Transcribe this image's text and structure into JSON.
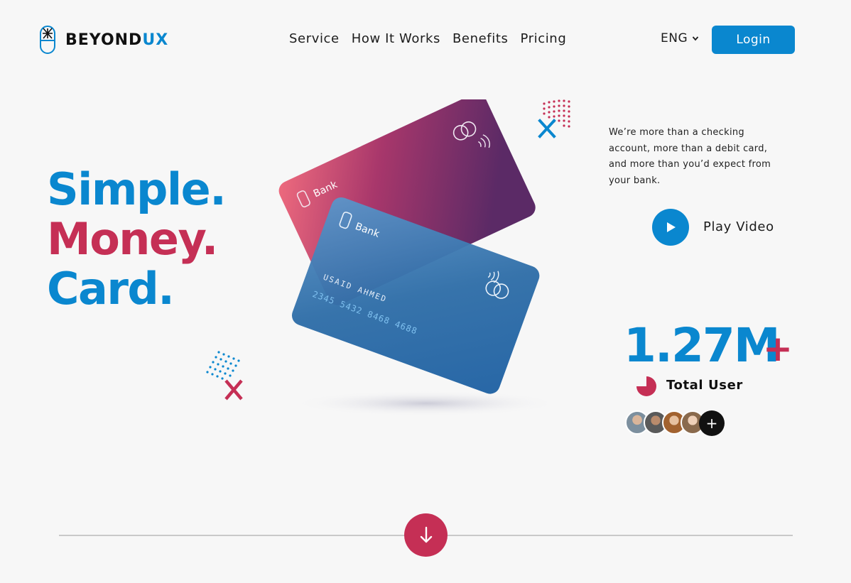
{
  "brand": {
    "name_part1": "BEYOND",
    "name_part2": "UX"
  },
  "nav": [
    {
      "label": "Service"
    },
    {
      "label": "How It Works"
    },
    {
      "label": "Benefits"
    },
    {
      "label": "Pricing"
    }
  ],
  "language": {
    "selected": "ENG"
  },
  "login_label": "Login",
  "hero": {
    "line1": "Simple.",
    "line2": "Money.",
    "line3": "Card."
  },
  "cards": {
    "back_bank": "Bank",
    "front_bank": "Bank",
    "holder": "USAID AHMED",
    "number": "2345 5432 8468 4688"
  },
  "description": "We’re more than a checking account, more than a debit card, and more than you’d expect from your bank.",
  "play_label": "Play Video",
  "stats": {
    "value": "1.27M",
    "suffix": "+",
    "label": "Total User",
    "add_label": "+"
  },
  "colors": {
    "blue": "#0a87cf",
    "crimson": "#c52f55",
    "background": "#f7f7f7"
  },
  "icons": {
    "logo": "brand-logo-icon",
    "chevron": "chevron-down-icon",
    "play": "play-icon",
    "scroll": "arrow-down-icon",
    "pie": "pie-chart-icon"
  }
}
